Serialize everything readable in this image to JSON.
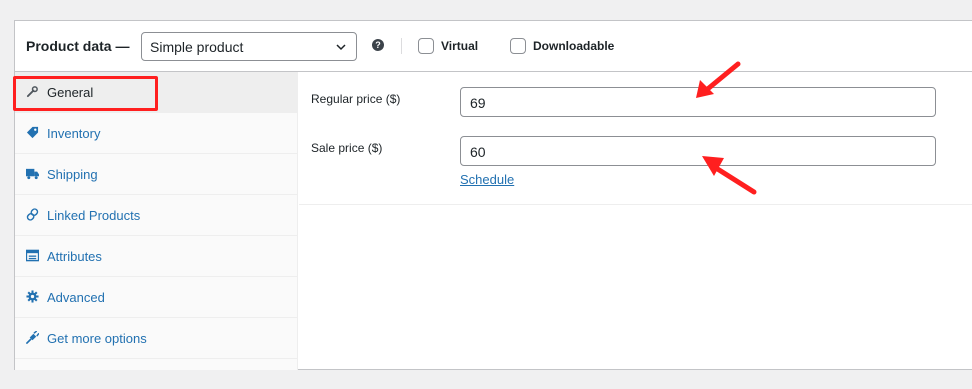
{
  "header": {
    "title": "Product data —",
    "product_type": "Simple product",
    "help": "?",
    "virtual_label": "Virtual",
    "virtual_checked": false,
    "downloadable_label": "Downloadable",
    "downloadable_checked": false
  },
  "tabs": [
    {
      "label": "General",
      "icon": "wrench-icon",
      "active": true
    },
    {
      "label": "Inventory",
      "icon": "tag-icon",
      "active": false
    },
    {
      "label": "Shipping",
      "icon": "truck-icon",
      "active": false
    },
    {
      "label": "Linked Products",
      "icon": "link-icon",
      "active": false
    },
    {
      "label": "Attributes",
      "icon": "list-icon",
      "active": false
    },
    {
      "label": "Advanced",
      "icon": "gear-icon",
      "active": false
    },
    {
      "label": "Get more options",
      "icon": "plugin-icon",
      "active": false
    }
  ],
  "general": {
    "regular_price_label": "Regular price ($)",
    "regular_price_value": "69",
    "sale_price_label": "Sale price ($)",
    "sale_price_value": "60",
    "schedule_link": "Schedule"
  },
  "colors": {
    "accent": "#2271b1",
    "annotation": "#ff1f1f",
    "border": "#c3c4c7"
  }
}
